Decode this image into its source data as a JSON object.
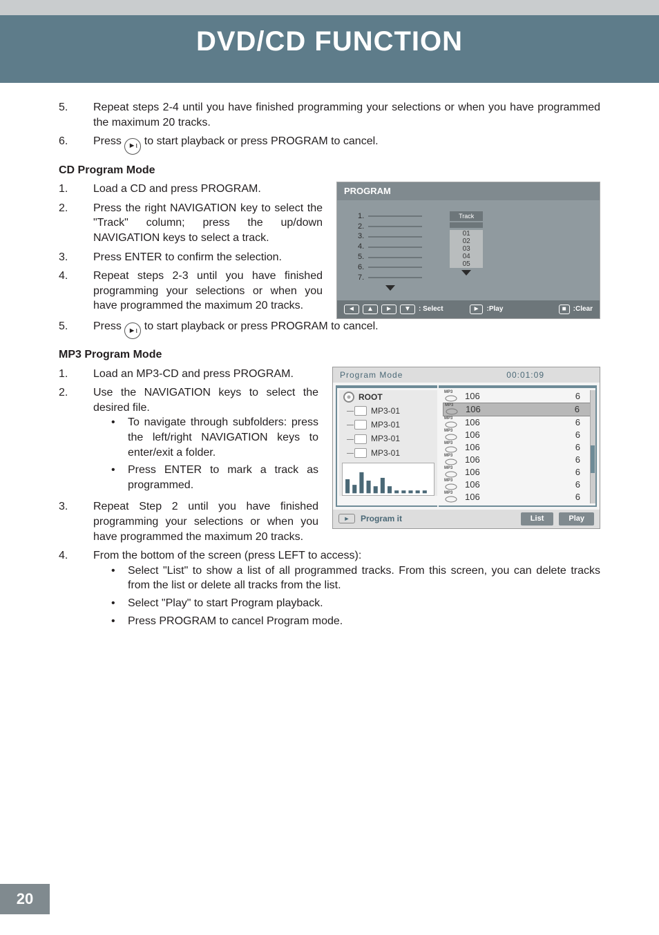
{
  "header": {
    "title": "DVD/CD FUNCTION"
  },
  "step5": "Repeat steps 2-4 until you have finished programming your selections or when you have programmed the maximum 20 tracks.",
  "step6_pre": "Press ",
  "step6_post": " to start playback or press PROGRAM to cancel.",
  "cd": {
    "heading": "CD Program Mode",
    "s1": "Load a CD and press PROGRAM.",
    "s2": "Press the right NAVIGATION key to select the \"Track\" column; press the up/down NAVIGATION keys to select a track.",
    "s3": "Press ENTER to confirm the selection.",
    "s4": "Repeat steps 2-3 until you have finished programming your selections or when you have programmed the maximum 20 tracks.",
    "s5_pre": "Press ",
    "s5_post": " to start playback or press PROGRAM to cancel."
  },
  "program_panel": {
    "title": "PROGRAM",
    "rows": [
      "1.",
      "2.",
      "3.",
      "4.",
      "5.",
      "6.",
      "7."
    ],
    "track_head": "Track",
    "tracks": [
      "01",
      "02",
      "03",
      "04",
      "05"
    ],
    "select": ": Select",
    "play": ":Play",
    "clear": ":Clear"
  },
  "mp3": {
    "heading": "MP3 Program Mode",
    "s1": "Load an MP3-CD and press PROGRAM.",
    "s2": "Use the NAVIGATION keys to select the desired file.",
    "s2a": "To navigate through subfolders: press the left/right NAVIGATION keys to enter/exit a folder.",
    "s2b": "Press ENTER to mark a track as programmed.",
    "s3": "Repeat Step 2 until you have finished programming your selections or when you have programmed the maximum 20 tracks.",
    "s4": "From the bottom of the screen (press LEFT to access):",
    "s4a": "Select \"List\" to show a list of all programmed tracks. From this screen, you can delete tracks from the list or delete all tracks from the list.",
    "s4b": "Select \"Play\" to start Program playback.",
    "s4c": "Press PROGRAM to cancel Program mode."
  },
  "mp3_panel": {
    "mode": "Program Mode",
    "time": "00:01:09",
    "root": "ROOT",
    "folders": [
      "MP3-01",
      "MP3-01",
      "MP3-01",
      "MP3-01"
    ],
    "rows": [
      {
        "t": "106",
        "n": "6"
      },
      {
        "t": "106",
        "n": "6"
      },
      {
        "t": "106",
        "n": "6"
      },
      {
        "t": "106",
        "n": "6"
      },
      {
        "t": "106",
        "n": "6"
      },
      {
        "t": "106",
        "n": "6"
      },
      {
        "t": "106",
        "n": "6"
      },
      {
        "t": "106",
        "n": "6"
      },
      {
        "t": "106",
        "n": "6"
      }
    ],
    "program_it": "Program it",
    "list": "List",
    "play": "Play"
  },
  "page": "20"
}
